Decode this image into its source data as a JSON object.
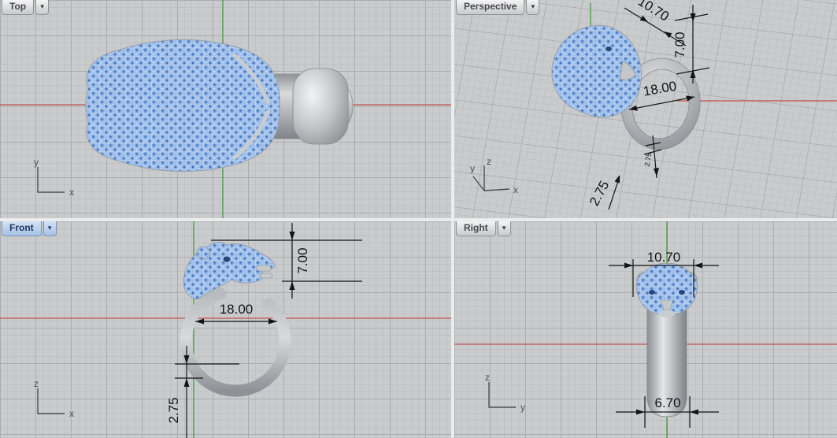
{
  "viewports": {
    "top": {
      "label": "Top",
      "axes": {
        "vertical": "y",
        "horizontal": "x"
      }
    },
    "perspective": {
      "label": "Perspective",
      "axes": {
        "vertical": "z",
        "diagonal": "y",
        "horizontal": "x"
      },
      "dimensions": {
        "head_width": "10.70",
        "head_height": "7.00",
        "inner_diameter": "18.00",
        "band_thickness": "2.75",
        "band_thickness_note": "2.75"
      }
    },
    "front": {
      "label": "Front",
      "axes": {
        "vertical": "z",
        "horizontal": "x"
      },
      "dimensions": {
        "head_height": "7.00",
        "inner_diameter": "18.00",
        "band_thickness": "2.75"
      }
    },
    "right": {
      "label": "Right",
      "axes": {
        "vertical": "z",
        "horizontal": "y"
      },
      "dimensions": {
        "head_width": "10.70",
        "band_width": "6.70"
      }
    }
  },
  "icons": {
    "viewport_menu": "▾"
  },
  "colors": {
    "axis_x_red": "#c0504d",
    "axis_y_green": "#3f9b41",
    "active_tab_blue": "#a6c2e6",
    "pave_blue": "#8fb4e8",
    "metal_gray": "#b0b3b6"
  }
}
